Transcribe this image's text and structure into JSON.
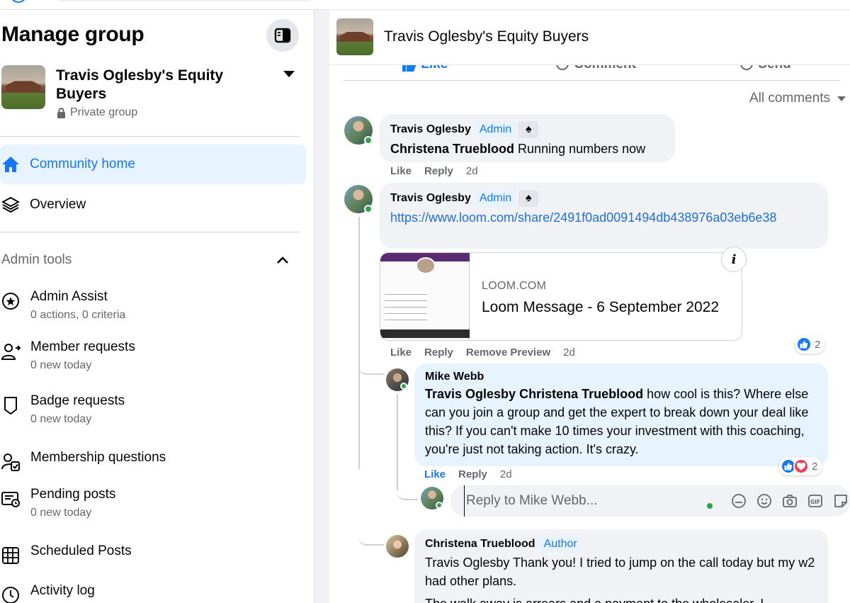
{
  "sidebar": {
    "title": "Manage group",
    "group": {
      "name": "Travis Oglesby's Equity Buyers",
      "privacy": "Private group"
    },
    "nav": [
      {
        "label": "Community home"
      },
      {
        "label": "Overview"
      }
    ],
    "admin_tools_label": "Admin tools",
    "tools": [
      {
        "title": "Admin Assist",
        "sub": "0 actions, 0 criteria"
      },
      {
        "title": "Member requests",
        "sub": "0 new today"
      },
      {
        "title": "Badge requests",
        "sub": "0 new today"
      },
      {
        "title": "Membership questions",
        "sub": ""
      },
      {
        "title": "Pending posts",
        "sub": "0 new today"
      },
      {
        "title": "Scheduled Posts",
        "sub": ""
      },
      {
        "title": "Activity log",
        "sub": ""
      }
    ]
  },
  "post": {
    "header_title": "Travis Oglesby's Equity Buyers",
    "actions": [
      "Like",
      "Comment",
      "Send"
    ],
    "sort_label": "All comments"
  },
  "comments": {
    "c1": {
      "author": "Travis Oglesby",
      "badge": "Admin",
      "mention": "Christena Trueblood",
      "text": "Running numbers now",
      "like": "Like",
      "reply": "Reply",
      "time": "2d"
    },
    "c2": {
      "author": "Travis Oglesby",
      "badge": "Admin",
      "link": "https://www.loom.com/share/2491f0ad0091494db438976a03eb6e38",
      "preview_domain": "LOOM.COM",
      "preview_title": "Loom Message - 6 September 2022",
      "like": "Like",
      "reply": "Reply",
      "remove_preview": "Remove Preview",
      "time": "2d",
      "reactions": "2"
    },
    "c3": {
      "author": "Mike Webb",
      "mention": "Travis Oglesby Christena Trueblood",
      "text": "how cool is this? Where else can you join a group and get the expert to break down your deal like this? If you can't make 10 times your investment with this coaching, you're just not taking action. It's crazy.",
      "like": "Like",
      "reply": "Reply",
      "time": "2d",
      "reactions": "2"
    },
    "reply_placeholder": "Reply to Mike Webb...",
    "c4": {
      "author": "Christena Trueblood",
      "badge": "Author",
      "text": "Travis Oglesby Thank you! I tried to jump on the call today but my w2 had other plans.",
      "text2": "The walk away is arrears and a payment to the wholesaler. I"
    }
  },
  "colors": {
    "accent": "#1877f2",
    "active_bg": "#e7f3ff",
    "bubble": "#f0f2f5",
    "online": "#31a24c"
  }
}
